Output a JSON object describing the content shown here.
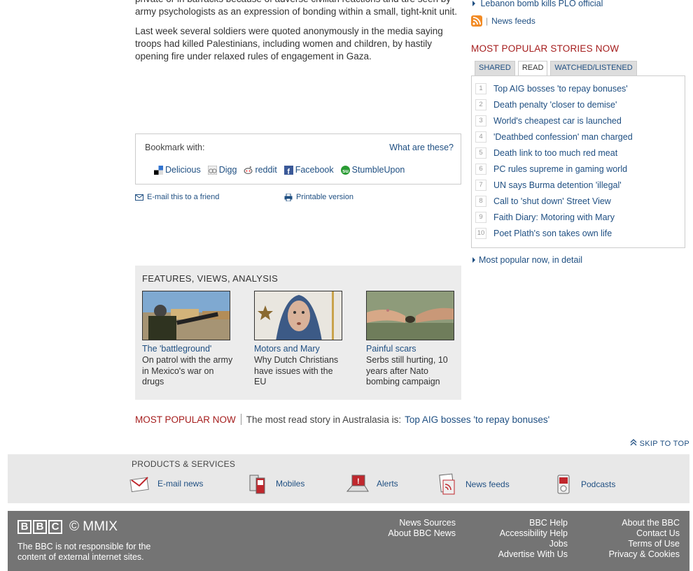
{
  "article": {
    "p1": "private or in barracks because of adverse civilian reactions and are seen by army psychologists as an expression of bonding within a small, tight-knit unit.",
    "p2": "Last week several soldiers were quoted anonymously in the media saying troops had killed Palestinians, including women and children, by hastily opening fire under relaxed rules of engagement in Gaza."
  },
  "bookmark": {
    "label": "Bookmark with:",
    "what": "What are these?",
    "links": [
      "Delicious",
      "Digg",
      "reddit",
      "Facebook",
      "StumbleUpon"
    ]
  },
  "util": {
    "email": "E-mail this to a friend",
    "print": "Printable version"
  },
  "features": {
    "title": "FEATURES, VIEWS, ANALYSIS",
    "items": [
      {
        "head": "The 'battleground'",
        "desc": "On patrol with the army in Mexico's war on drugs"
      },
      {
        "head": "Motors and Mary",
        "desc": "Why Dutch Christians have issues with the EU"
      },
      {
        "head": "Painful scars",
        "desc": "Serbs still hurting, 10 years after Nato bombing campaign"
      }
    ]
  },
  "mpnow": {
    "label": "MOST POPULAR NOW",
    "text": "The most read story in Australasia is:",
    "link": "Top AIG bosses 'to repay bonuses'"
  },
  "skip": "SKIP TO TOP",
  "products": {
    "title": "PRODUCTS & SERVICES",
    "items": [
      "E-mail news",
      "Mobiles",
      "Alerts",
      "News feeds",
      "Podcasts"
    ]
  },
  "footer": {
    "logo_letters": [
      "B",
      "B",
      "C"
    ],
    "copyright": "© MMIX",
    "note": "The BBC is not responsible for the content of external internet sites.",
    "col1": [
      "News Sources",
      "About BBC News"
    ],
    "col2": [
      "BBC Help",
      "Accessibility Help",
      "Jobs",
      "Advertise With Us"
    ],
    "col3": [
      "About the BBC",
      "Contact Us",
      "Terms of Use",
      "Privacy & Cookies"
    ]
  },
  "right": {
    "top_link": "Lebanon bomb kills PLO official",
    "feeds": "News feeds",
    "mp_title": "MOST POPULAR STORIES NOW",
    "tabs": [
      "SHARED",
      "READ",
      "WATCHED/LISTENED"
    ],
    "stories": [
      {
        "n": "1",
        "t": "Top AIG bosses 'to repay bonuses'"
      },
      {
        "n": "2",
        "t": "Death penalty 'closer to demise'"
      },
      {
        "n": "3",
        "t": "World's cheapest car is launched"
      },
      {
        "n": "4",
        "t": "'Deathbed confession' man charged"
      },
      {
        "n": "5",
        "t": "Death link to too much red meat"
      },
      {
        "n": "6",
        "t": "PC rules supreme in gaming world"
      },
      {
        "n": "7",
        "t": "UN says Burma detention 'illegal'"
      },
      {
        "n": "8",
        "t": "Call to 'shut down' Street View"
      },
      {
        "n": "9",
        "t": "Faith Diary: Motoring with Mary"
      },
      {
        "n": "10",
        "t": "Poet Plath's son takes own life"
      }
    ],
    "detail": "Most popular now, in detail"
  },
  "colors": {
    "link": "#1f4f82",
    "red": "#a51d1d",
    "footer_bg": "#747474"
  }
}
